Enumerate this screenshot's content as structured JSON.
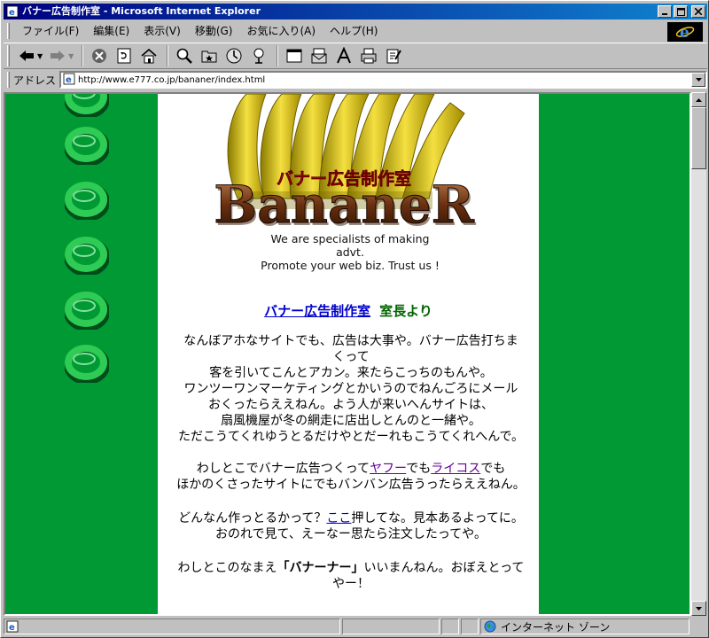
{
  "window": {
    "title": "バナー広告制作室 - Microsoft Internet Explorer"
  },
  "menu": [
    {
      "label": "ファイル(F)"
    },
    {
      "label": "編集(E)"
    },
    {
      "label": "表示(V)"
    },
    {
      "label": "移動(G)"
    },
    {
      "label": "お気に入り(A)"
    },
    {
      "label": "ヘルプ(H)"
    }
  ],
  "address": {
    "label": "アドレス",
    "url": "http://www.e777.co.jp/bananer/index.html"
  },
  "logo": {
    "title_jp": "バナー広告制作室",
    "brand": "BananeR",
    "tagline_1": "We are specialists of making advt.",
    "tagline_2": "Promote your web biz. Trust us !"
  },
  "heading": {
    "link": "バナー広告制作室",
    "sub": "室長より"
  },
  "para1": {
    "line1": "なんぼアホなサイトでも、広告は大事や。バナー広告打ちま",
    "line2": "くって",
    "line3": "客を引いてこんとアカン。来たらこっちのもんや。",
    "line4": "ワンツーワンマーケティングとかいうのでねんごろにメール",
    "line5": "おくったらええねん。よう人が来いへんサイトは、",
    "line6": "扇風機屋が冬の網走に店出しとんのと一緒や。",
    "line7": "ただこうてくれゆうとるだけやとだーれもこうてくれへんで。"
  },
  "para2": {
    "pre": "わしとこでバナー広告つくって",
    "link_yahoo": "ヤフー",
    "mid": "でも",
    "link_lycos": "ライコス",
    "post": "でも",
    "line2": "ほかのくさったサイトにでもバンバン広告うったらええねん。"
  },
  "para3": {
    "pre": "どんなん作っとるかって？",
    "link_here": "ここ",
    "post": "押してな。見本あるよってに。",
    "line2": "おのれで見て、えーなー思たら注文したってや。"
  },
  "para4": {
    "pre": "わしとこのなまえ",
    "bold": "「バナーナー」",
    "post": "いいまんねん。おぼえとって",
    "line2": "やー！"
  },
  "status": {
    "zone": "インターネット ゾーン"
  }
}
